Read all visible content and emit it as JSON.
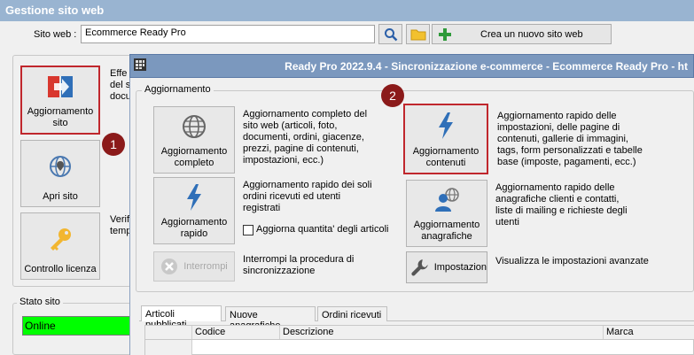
{
  "parent": {
    "title": "Gestione sito web",
    "site_label": "Sito web :",
    "site_value": "Ecommerce Ready Pro",
    "new_site_label": "Crea un nuovo sito web",
    "buttons": {
      "aggiornamento_sito_line1": "Aggiornamento",
      "aggiornamento_sito_line2": "sito",
      "apri_sito": "Apri sito",
      "controllo_licenza": "Controllo licenza"
    },
    "side_text": {
      "a1": "Effe",
      "a2": "del s",
      "a3": "docu",
      "b1": "Verif",
      "b2": "temp"
    },
    "stato_label": "Stato sito",
    "stato_value": "Online",
    "badge1": "1"
  },
  "child": {
    "title": "Ready Pro 2022.9.4 - Sincronizzazione e-commerce - Ecommerce Ready Pro - ht",
    "group_label": "Aggiornamento",
    "badge2": "2",
    "completo": {
      "line1": "Aggiornamento",
      "line2": "completo",
      "desc": [
        "Aggiornamento completo del",
        "sito web (articoli, foto,",
        "documenti, ordini, giacenze,",
        "prezzi, pagine di contenuti,",
        "impostazioni, ecc.)"
      ]
    },
    "contenuti": {
      "line1": "Aggiornamento",
      "line2": "contenuti",
      "desc": [
        "Aggiornamento rapido delle",
        "impostazioni, delle pagine di",
        "contenuti, gallerie di immagini,",
        "tags, form personalizzati e tabelle",
        "base (imposte, pagamenti, ecc.)"
      ]
    },
    "rapido": {
      "line1": "Aggiornamento",
      "line2": "rapido",
      "desc": [
        "Aggiornamento rapido dei soli",
        "ordini ricevuti ed utenti",
        "registrati"
      ],
      "checkbox_label": "Aggiorna quantita' degli articoli"
    },
    "anagrafiche": {
      "line1": "Aggiornamento",
      "line2": "anagrafiche",
      "desc": [
        "Aggiornamento rapido delle",
        "anagrafiche clienti e contatti,",
        "liste di mailing e richieste degli",
        "utenti"
      ]
    },
    "interrompi": {
      "label": "Interrompi",
      "desc": [
        "Interrompi la procedura di",
        "sincronizzazione"
      ]
    },
    "impostazioni": {
      "label": "Impostazion",
      "desc": "Visualizza le impostazioni avanzate"
    },
    "tabs": [
      "Articoli pubblicati",
      "Nuove anagrafiche",
      "Ordini ricevuti"
    ],
    "grid_columns": [
      "Codice",
      "Descrizione",
      "Marca"
    ]
  }
}
